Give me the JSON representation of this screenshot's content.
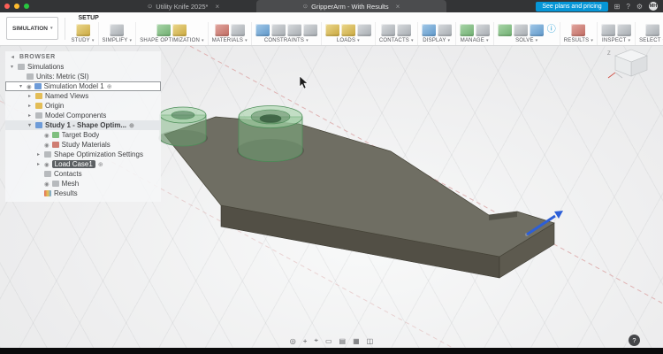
{
  "window": {
    "tabs": [
      {
        "title": "Utility Knife 2025*"
      },
      {
        "title": "GripperArm - With Results"
      }
    ],
    "cta": "See plans and pricing",
    "avatar": "MH"
  },
  "toolbar": {
    "workspace": "SIMULATION",
    "tab": "SETUP",
    "groups": [
      {
        "label": "STUDY"
      },
      {
        "label": "SIMPLIFY"
      },
      {
        "label": "SHAPE OPTIMIZATION"
      },
      {
        "label": "MATERIALS"
      },
      {
        "label": "CONSTRAINTS"
      },
      {
        "label": "LOADS"
      },
      {
        "label": "CONTACTS"
      },
      {
        "label": "DISPLAY"
      },
      {
        "label": "MANAGE"
      },
      {
        "label": "SOLVE"
      },
      {
        "label": "RESULTS"
      },
      {
        "label": "INSPECT"
      },
      {
        "label": "SELECT"
      }
    ]
  },
  "browser": {
    "header": "BROWSER",
    "items": [
      {
        "label": "Simulations"
      },
      {
        "label": "Units: Metric (SI)"
      },
      {
        "label": "Simulation Model 1"
      },
      {
        "label": "Named Views"
      },
      {
        "label": "Origin"
      },
      {
        "label": "Model Components"
      },
      {
        "label": "Study 1 - Shape Optim..."
      },
      {
        "label": "Target Body"
      },
      {
        "label": "Study Materials"
      },
      {
        "label": "Shape Optimization Settings"
      },
      {
        "label": "Load Case1"
      },
      {
        "label": "Contacts"
      },
      {
        "label": "Mesh"
      },
      {
        "label": "Results"
      }
    ]
  },
  "viewport": {
    "viewcube_label": "Z"
  },
  "nav": {
    "icons": [
      {
        "name": "orbit-icon",
        "glyph": "◎"
      },
      {
        "name": "pan-icon",
        "glyph": "+"
      },
      {
        "name": "center-icon",
        "glyph": "⌖"
      },
      {
        "name": "fit-icon",
        "glyph": "▭"
      },
      {
        "name": "display-settings-icon",
        "glyph": "▤"
      },
      {
        "name": "grid-settings-icon",
        "glyph": "▦"
      },
      {
        "name": "viewports-icon",
        "glyph": "◫"
      }
    ]
  },
  "icons": {
    "caret_down": "▾",
    "caret_right": "▸",
    "collapse_left": "◂",
    "eye": "◉",
    "active_badge": "⊕",
    "close": "×",
    "favicon": "⊙",
    "info": "ⓘ",
    "apps": "⊞",
    "gear": "⚙",
    "help": "?"
  },
  "colors": {
    "accent_blue": "#0696d7",
    "selection_green": "#7fbf7f",
    "load_arrow_blue": "#2c5fd8",
    "axis_pink": "#dca8a8",
    "part_top": "#6f6e63"
  }
}
